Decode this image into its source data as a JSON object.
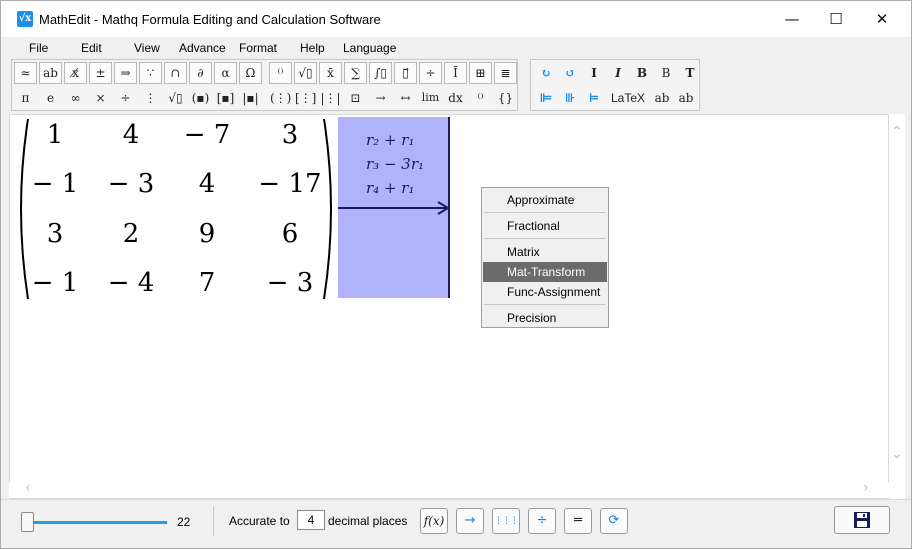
{
  "window": {
    "title": "MathEdit - Mathq Formula Editing and Calculation Software",
    "app_icon": "√x",
    "controls": {
      "minimize": "—",
      "maximize": "☐",
      "close": "✕"
    }
  },
  "menu": [
    "File",
    "Edit",
    "View",
    "Advance",
    "Format",
    "Help",
    "Language"
  ],
  "toolbar": {
    "row1": [
      "≈",
      "ab",
      "x̸",
      "±",
      "⇒",
      "∵",
      "∩",
      "∂",
      "α",
      "Ω",
      "⁽⁾",
      "√▯",
      "x̄",
      "∑",
      "∫▯",
      "▯⃗",
      "÷",
      "Ī",
      "⊞",
      "≣"
    ],
    "row2": [
      "π",
      "e",
      "∞",
      "×",
      "÷",
      "⋮",
      "√▯",
      "(▪)",
      "[▪]",
      "|▪|",
      "(⋮)",
      "[⋮]",
      "|⋮|",
      "⊡",
      "→",
      "↔",
      "lim",
      "dx",
      "⁽⁾",
      "{}"
    ],
    "format_row1": [
      "↻",
      "↺",
      "I",
      "I",
      "B",
      "B",
      "T"
    ],
    "format_row2": [
      "⊫",
      "⊪",
      "⊨",
      "LaTeX",
      "ab",
      "ab"
    ]
  },
  "matrix": {
    "rows": [
      [
        "1",
        "4",
        "− 7",
        "3"
      ],
      [
        "− 1",
        "− 3",
        "4",
        "− 17"
      ],
      [
        "3",
        "2",
        "9",
        "6"
      ],
      [
        "− 1",
        "− 4",
        "7",
        "− 3"
      ]
    ]
  },
  "transform": {
    "operations": [
      "r₂ + r₁",
      "r₃ − 3r₁",
      "r₄ + r₁"
    ]
  },
  "context_menu": {
    "items": [
      "Approximate",
      "Fractional",
      "Matrix",
      "Mat-Transform",
      "Func-Assignment",
      "Precision"
    ],
    "active": "Mat-Transform"
  },
  "statusbar": {
    "slider_value": "22",
    "slider_position": 0.03,
    "accurate_label": "Accurate to",
    "decimals": "4",
    "decimal_places_label": "decimal places",
    "buttons": [
      "f(x)",
      "→",
      "⋮⋮⋮",
      "÷",
      "═",
      "⟳"
    ],
    "save_icon": "floppy-disk-icon"
  },
  "scroll": {
    "up": "⌃",
    "down": "⌄",
    "left": "‹",
    "right": "›"
  },
  "colors": {
    "accent": "#1e8fe8",
    "transform_bg": "#b0b2fb",
    "menu_highlight": "#6b6b6b",
    "slider": "#1ea0e0"
  }
}
